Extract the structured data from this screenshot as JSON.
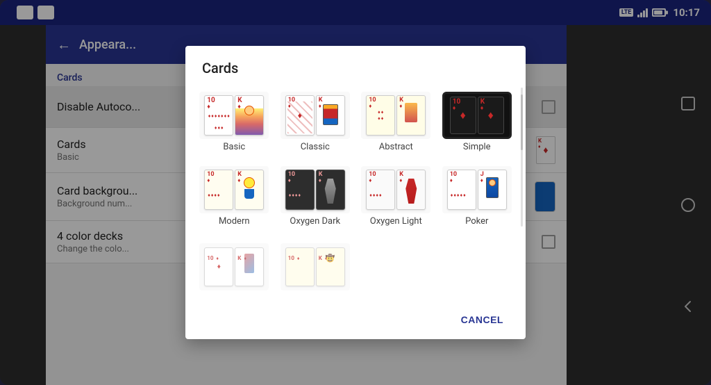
{
  "statusBar": {
    "time": "10:17",
    "lte": "LTE",
    "battery_pct": 80
  },
  "topBar": {
    "title": "Appeara...",
    "back_label": "←"
  },
  "settingsList": {
    "sectionLabel": "Cards",
    "items": [
      {
        "id": "disable-autocomplete",
        "title": "Disable Autoco...",
        "subtitle": "",
        "rightType": "checkbox"
      },
      {
        "id": "cards",
        "title": "Cards",
        "subtitle": "Basic",
        "rightType": "card-preview"
      },
      {
        "id": "card-background",
        "title": "Card backgrou...",
        "subtitle": "Background num...",
        "rightType": "card-back"
      },
      {
        "id": "four-color-decks",
        "title": "4 color decks",
        "subtitle": "Change the colo...",
        "rightType": "checkbox"
      }
    ]
  },
  "dialog": {
    "title": "Cards",
    "cancelLabel": "CANCEL",
    "options": [
      {
        "id": "basic",
        "label": "Basic",
        "selected": false
      },
      {
        "id": "classic",
        "label": "Classic",
        "selected": false
      },
      {
        "id": "abstract",
        "label": "Abstract",
        "selected": false
      },
      {
        "id": "simple",
        "label": "Simple",
        "selected": true
      },
      {
        "id": "modern",
        "label": "Modern",
        "selected": false
      },
      {
        "id": "oxygen-dark",
        "label": "Oxygen Dark",
        "selected": false
      },
      {
        "id": "oxygen-light",
        "label": "Oxygen Light",
        "selected": false
      },
      {
        "id": "poker",
        "label": "Poker",
        "selected": false
      }
    ]
  },
  "navButtons": {
    "square": "□",
    "circle": "○",
    "back": "◁"
  },
  "icons": {
    "wifi": "▲",
    "notification1": "⬜",
    "notification2": "☻"
  }
}
